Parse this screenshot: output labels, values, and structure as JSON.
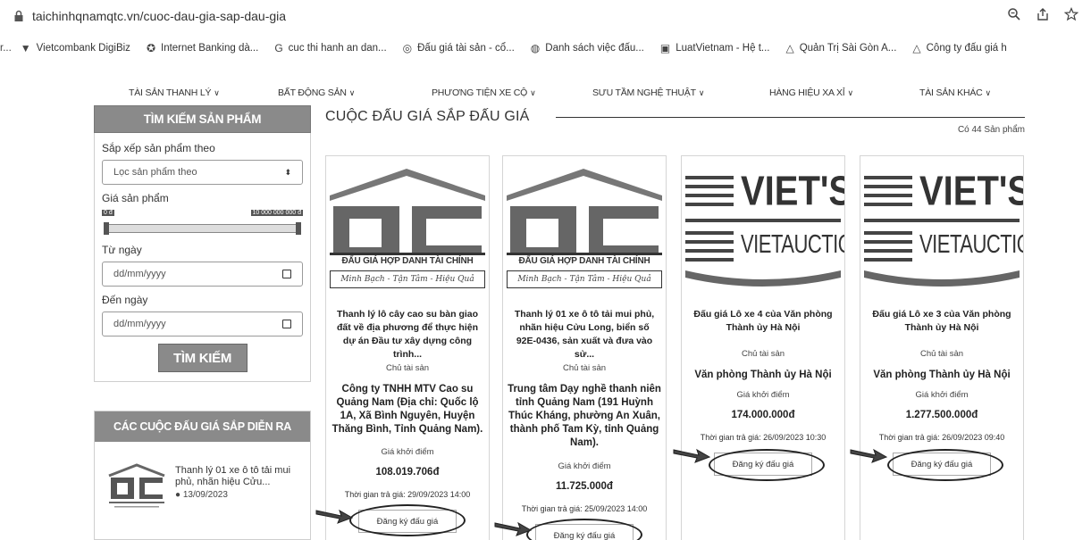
{
  "browser": {
    "url": "taichinhqnamqtc.vn/cuoc-dau-gia-sap-dau-gia"
  },
  "bookmarks": [
    {
      "label": "Vietcombank DigiBiz"
    },
    {
      "label": "Internet Banking dà..."
    },
    {
      "label": "cuc thi hanh an dan..."
    },
    {
      "label": "Đấu giá tài sản - cổ..."
    },
    {
      "label": "Danh sách việc đấu..."
    },
    {
      "label": "LuatVietnam - Hệ t..."
    },
    {
      "label": "Quản Trị Sài Gòn A..."
    },
    {
      "label": "Công ty đấu giá h"
    }
  ],
  "catnav": [
    {
      "label": "TÀI SẢN THANH LÝ"
    },
    {
      "label": "BẤT ĐỘNG SẢN"
    },
    {
      "label": "PHƯƠNG TIỆN XE CỘ"
    },
    {
      "label": "SƯU TẦM NGHỆ THUẬT"
    },
    {
      "label": "HÀNG HIỆU XA XỈ"
    },
    {
      "label": "TÀI SẢN KHÁC"
    }
  ],
  "sidebar": {
    "search_title": "TÌM KIẾM SẢN PHẨM",
    "sort_label": "Sắp xếp sản phẩm theo",
    "sort_value": "Lọc sản phẩm theo",
    "price_label": "Giá sản phẩm",
    "price_min": "0 đ",
    "price_max": "10 000 000 000 đ",
    "from_label": "Từ ngày",
    "from_value": "dd/mm/yyyy",
    "to_label": "Đến ngày",
    "to_value": "dd/mm/yyyy",
    "search_button": "TÌM KIẾM",
    "upcoming_title": "CÁC CUỘC ĐẤU GIÁ SẮP DIỄN RA",
    "upcoming_item": {
      "title": "Thanh lý 01 xe ô tô tải mui phủ, nhãn hiệu Cửu...",
      "date": "13/09/2023"
    }
  },
  "main": {
    "title": "CUỘC ĐẤU GIÁ SẮP ĐẤU GIÁ",
    "count": "Có 44 Sản phẩm"
  },
  "logo_text": {
    "qtc_caption": "ĐẤU GIÁ HỢP DANH TÀI CHÍNH",
    "qtc_slogan": "Minh Bạch - Tận Tâm - Hiệu Quả",
    "viet_top": "VIET'S",
    "viet_bottom": "VIETAUCTION"
  },
  "cards": [
    {
      "title": "Thanh lý lô cây cao su bàn giao đất về địa phương để thực hiện dự án Đầu tư xây dựng công trình...",
      "owner_label": "Chủ tài sản",
      "owner": "Công ty TNHH MTV Cao su Quảng Nam (Địa chỉ: Quốc lộ 1A, Xã Bình Nguyên, Huyện Thăng Bình, Tỉnh Quảng Nam).",
      "price_label": "Giá khởi điểm",
      "price": "108.019.706đ",
      "time": "Thời gian trả giá: 29/09/2023 14:00",
      "register": "Đăng ký đấu giá"
    },
    {
      "title": "Thanh lý 01 xe ô tô tải mui phủ, nhãn hiệu Cửu Long, biển số 92E-0436, sản xuất và đưa vào sử...",
      "owner_label": "Chủ tài sản",
      "owner": "Trung tâm Dạy nghề thanh niên tỉnh Quảng Nam (191 Huỳnh Thúc Kháng, phường An Xuân, thành phố Tam Kỳ, tỉnh Quảng Nam).",
      "price_label": "Giá khởi điểm",
      "price": "11.725.000đ",
      "time": "Thời gian trả giá: 25/09/2023 14:00",
      "register": "Đăng ký đấu giá"
    },
    {
      "title": "Đấu giá Lô xe 4 của Văn phòng Thành ủy Hà Nội",
      "owner_label": "Chủ tài sản",
      "owner": "Văn phòng Thành ủy Hà Nội",
      "price_label": "Giá khởi điểm",
      "price": "174.000.000đ",
      "time": "Thời gian trả giá: 26/09/2023 10:30",
      "register": "Đăng ký đấu giá"
    },
    {
      "title": "Đấu giá Lô xe 3 của Văn phòng Thành ủy Hà Nội",
      "owner_label": "Chủ tài sản",
      "owner": "Văn phòng Thành ủy Hà Nội",
      "price_label": "Giá khởi điểm",
      "price": "1.277.500.000đ",
      "time": "Thời gian trả giá: 26/09/2023 09:40",
      "register": "Đăng ký đấu giá"
    }
  ]
}
